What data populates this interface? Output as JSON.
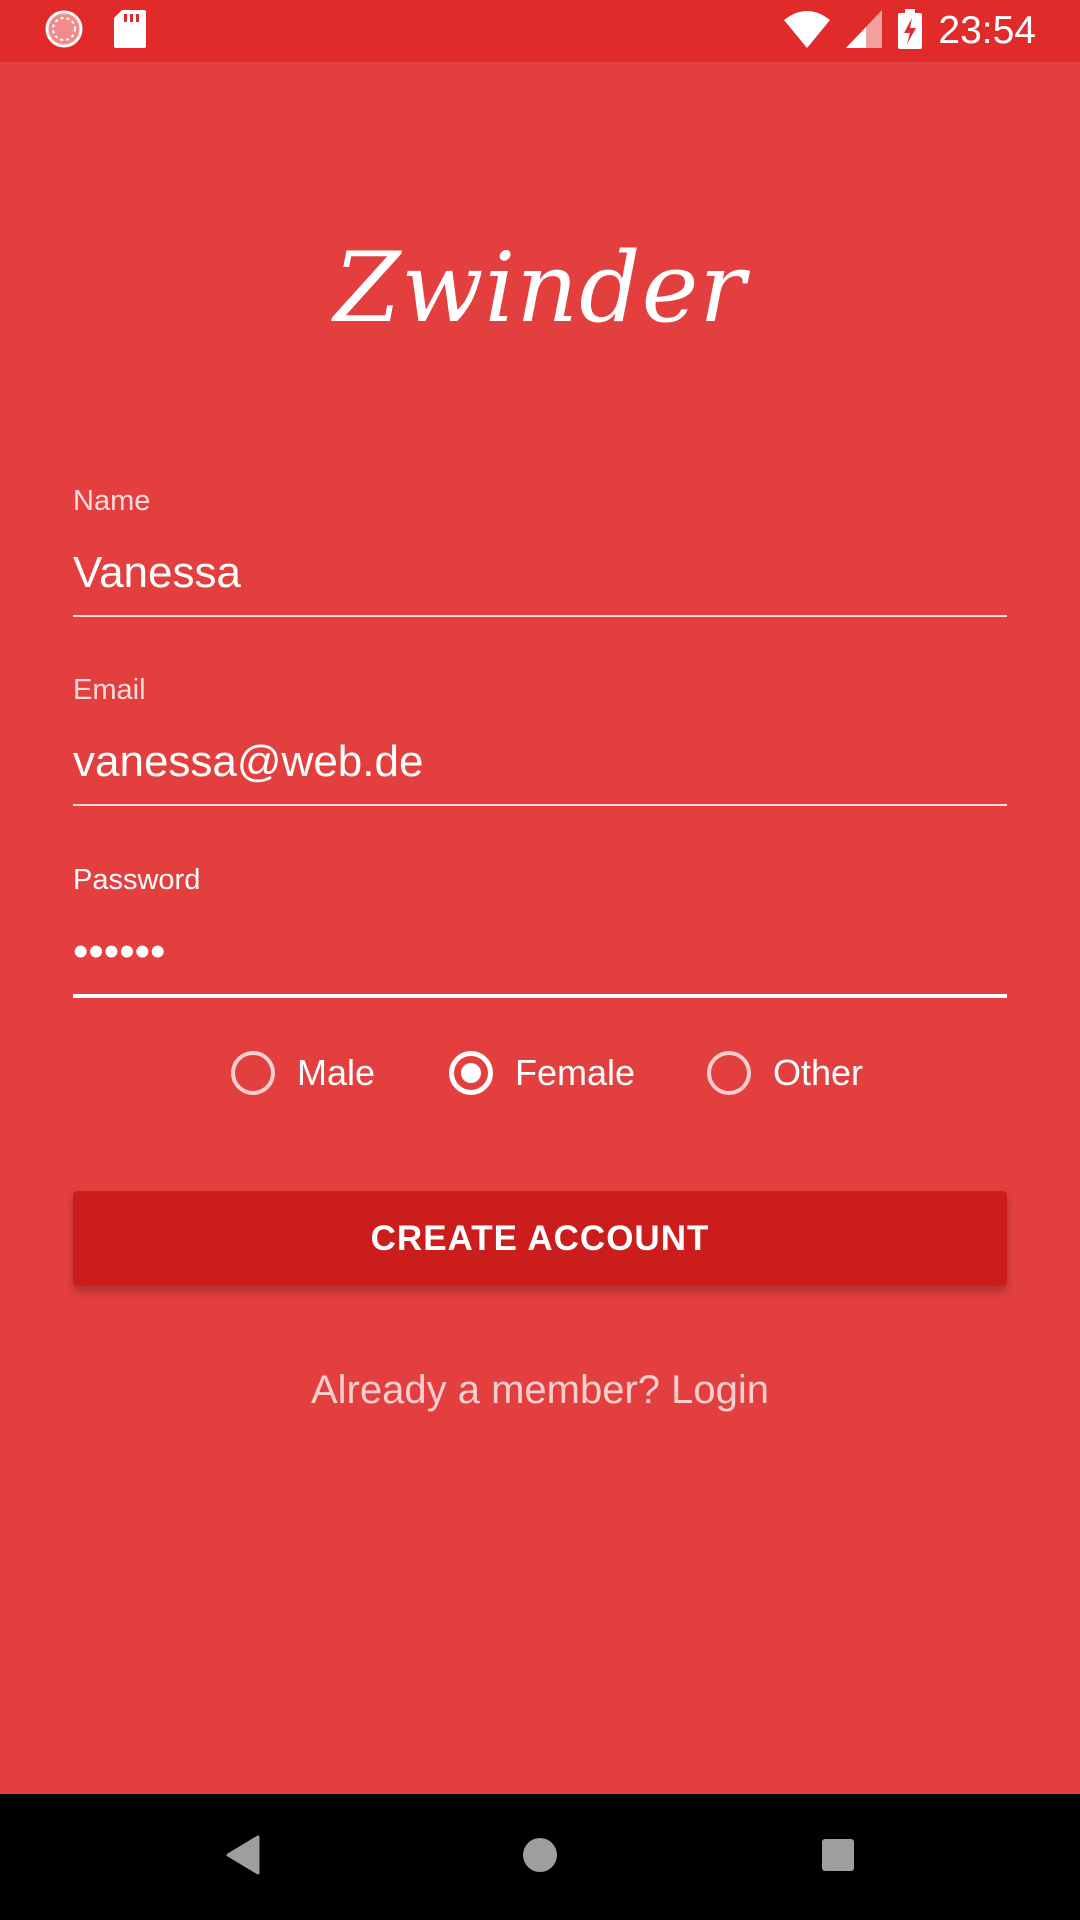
{
  "status_bar": {
    "time": "23:54",
    "icons": [
      "loading-icon",
      "sd-card-icon",
      "wifi-icon",
      "cell-signal-icon",
      "battery-charging-icon"
    ]
  },
  "app": {
    "logo": "Zwinder",
    "colors": {
      "background": "#e33f3f",
      "status_bar": "#e12a2a",
      "button": "#cc1d1d",
      "text": "#ffffff"
    }
  },
  "form": {
    "name": {
      "label": "Name",
      "value": "Vanessa"
    },
    "email": {
      "label": "Email",
      "value": "vanessa@web.de"
    },
    "password": {
      "label": "Password",
      "value": "••••••"
    },
    "gender": {
      "options": [
        "Male",
        "Female",
        "Other"
      ],
      "selected": "Female"
    },
    "create_button": "CREATE ACCOUNT",
    "login_link": "Already a member? Login"
  },
  "nav_bar": {
    "icons": [
      "back-icon",
      "home-icon",
      "recents-icon"
    ]
  }
}
